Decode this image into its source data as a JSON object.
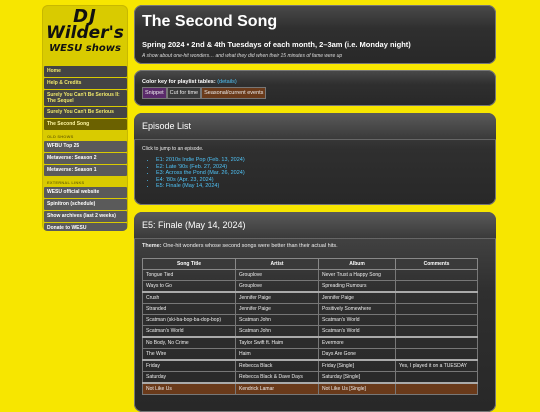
{
  "logo": {
    "line1": "DJ",
    "line2": "Wilder's",
    "line3": "WESU shows"
  },
  "nav": {
    "main": [
      {
        "label": "Home"
      },
      {
        "label": "Help & Credits"
      },
      {
        "label": "Surely You Can't Be Serious II: The Sequel"
      },
      {
        "label": "Surely You Can't Be Serious"
      },
      {
        "label": "The Second Song"
      }
    ],
    "old_heading": "OLD SHOWS",
    "old": [
      {
        "label": "WFBU Top 25"
      },
      {
        "label": "Metaverse: Season 2"
      },
      {
        "label": "Metaverse: Season 1"
      }
    ],
    "ext_heading": "EXTERNAL LINKS",
    "external": [
      {
        "label": "WESU official website"
      },
      {
        "label": "Spinitron (schedule)"
      },
      {
        "label": "Show archives (last 2 weeks)"
      },
      {
        "label": "Donate to WESU"
      }
    ]
  },
  "header": {
    "title": "The Second Song",
    "subtitle": "Spring 2024 • 2nd & 4th Tuesdays of each month, 2–3am (i.e. Monday night)",
    "description": "A show about one-hit wonders… and what they did when their 15 minutes of fame were up"
  },
  "colorkey": {
    "label": "Color key for playlist tables:",
    "details": "(details)",
    "snippet": "Snippet",
    "cut": "Cut for time",
    "seasonal": "Seasonal/current events"
  },
  "episodes": {
    "title": "Episode List",
    "hint": "Click to jump to an episode.",
    "items": [
      "E1: 2010s Indie Pop (Feb. 13, 2024)",
      "E2: Late '90s (Feb. 27, 2024)",
      "E3: Across the Pond (Mar. 26, 2024)",
      "E4: '80s (Apr. 23, 2024)",
      "E5: Finale (May 14, 2024)"
    ]
  },
  "ep5": {
    "title": "E5: Finale (May 14, 2024)",
    "theme_label": "Theme:",
    "theme_text": "One-hit wonders whose second songs were better than their actual hits.",
    "headers": [
      "Song Title",
      "Artist",
      "Album",
      "Comments"
    ],
    "rows": [
      [
        "Tongue Tied",
        "Grouplove",
        "Never Trust a Happy Song",
        ""
      ],
      [
        "Ways to Go",
        "Grouplove",
        "Spreading Rumours",
        ""
      ],
      [
        "Crush",
        "Jennifer Paige",
        "Jennifer Paige",
        ""
      ],
      [
        "Stranded",
        "Jennifer Paige",
        "Positively Somewhere",
        ""
      ],
      [
        "Scatman (ski-ba-bop-ba-dop-bop)",
        "Scatman John",
        "Scatman's World",
        ""
      ],
      [
        "Scatman's World",
        "Scatman John",
        "Scatman's World",
        ""
      ],
      [
        "No Body, No Crime",
        "Taylor Swift ft. Haim",
        "Evermore",
        ""
      ],
      [
        "The Wire",
        "Haim",
        "Days Are Gone",
        ""
      ],
      [
        "Friday",
        "Rebecca Black",
        "Friday [Single]",
        "Yes, I played it on a TUESDAY"
      ],
      [
        "Saturday",
        "Rebecca Black & Dave Days",
        "Saturday [Single]",
        ""
      ],
      [
        "Not Like Us",
        "Kendrick Lamar",
        "Not Like Us [Single]",
        ""
      ]
    ]
  }
}
